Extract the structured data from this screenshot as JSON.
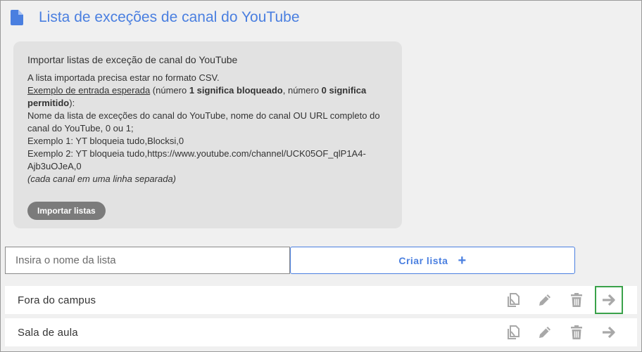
{
  "header": {
    "title": "Lista de exceções de canal do YouTube"
  },
  "import_card": {
    "title": "Importar listas de exceção de canal do YouTube",
    "line1": "A lista importada precisa estar no formato CSV.",
    "example_link": "Exemplo de entrada esperada",
    "example_rest_1": " (número ",
    "bold_1": "1 significa bloqueado",
    "example_rest_2": ", número ",
    "bold_2": "0 significa permitido",
    "example_rest_3": "):",
    "line3": "Nome da lista de exceções do canal do YouTube, nome do canal OU URL completo do canal do YouTube, 0 ou 1;",
    "line4": "Exemplo 1: YT bloqueia tudo,Blocksi,0",
    "line5": "Exemplo 2: YT bloqueia tudo,https://www.youtube.com/channel/UCK05OF_qlP1A4-Ajb3uOJeA,0",
    "line6": "(cada canal em uma linha separada)",
    "button_label": "Importar listas"
  },
  "create": {
    "input_placeholder": "Insira o nome da lista",
    "input_value": "",
    "button_label": "Criar lista",
    "button_icon": "plus-icon"
  },
  "lists": [
    {
      "name": "Fora do campus"
    },
    {
      "name": "Sala de aula"
    }
  ],
  "row_actions": [
    "copy-icon",
    "pencil-icon",
    "trash-icon",
    "arrow-right-icon"
  ],
  "colors": {
    "accent": "#4a7fe0",
    "highlight": "#3aa24a",
    "icon": "#a8a8a8",
    "card_bg": "#e2e2e2",
    "import_button": "#7b7b7b"
  }
}
